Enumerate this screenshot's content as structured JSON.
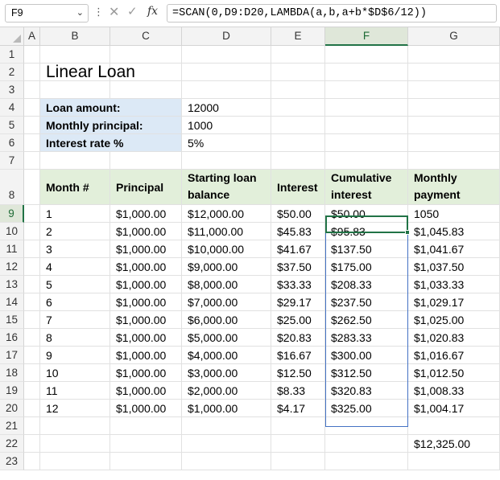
{
  "formula_bar": {
    "name_box": "F9",
    "formula": "=SCAN(0,D9:D20,LAMBDA(a,b,a+b*$D$6/12))",
    "cancel_icon": "close-icon",
    "enter_icon": "check-icon",
    "fx_label": "fx"
  },
  "columns": [
    "A",
    "B",
    "C",
    "D",
    "E",
    "F",
    "G"
  ],
  "rows": [
    "1",
    "2",
    "3",
    "4",
    "5",
    "6",
    "7",
    "8",
    "9",
    "10",
    "11",
    "12",
    "13",
    "14",
    "15",
    "16",
    "17",
    "18",
    "19",
    "20",
    "21",
    "22",
    "23"
  ],
  "selected_column": "F",
  "selected_row": "9",
  "sheet": {
    "title": "Linear Loan",
    "inputs": [
      {
        "label": "Loan amount:",
        "value": "12000"
      },
      {
        "label": "Monthly principal:",
        "value": "1000"
      },
      {
        "label": "Interest rate %",
        "value": "5%"
      }
    ],
    "table_headers": {
      "month": "Month #",
      "principal": "Principal",
      "starting_balance_1": "Starting loan",
      "starting_balance_2": "balance",
      "interest": "Interest",
      "cumulative_1": "Cumulative",
      "cumulative_2": "interest",
      "monthly_1": "Monthly",
      "monthly_2": "payment"
    },
    "table_rows": [
      {
        "month": "1",
        "principal": "$1,000.00",
        "balance": "$12,000.00",
        "interest": "$50.00",
        "cumulative": "$50.00",
        "payment": "1050"
      },
      {
        "month": "2",
        "principal": "$1,000.00",
        "balance": "$11,000.00",
        "interest": "$45.83",
        "cumulative": "$95.83",
        "payment": "$1,045.83"
      },
      {
        "month": "3",
        "principal": "$1,000.00",
        "balance": "$10,000.00",
        "interest": "$41.67",
        "cumulative": "$137.50",
        "payment": "$1,041.67"
      },
      {
        "month": "4",
        "principal": "$1,000.00",
        "balance": "$9,000.00",
        "interest": "$37.50",
        "cumulative": "$175.00",
        "payment": "$1,037.50"
      },
      {
        "month": "5",
        "principal": "$1,000.00",
        "balance": "$8,000.00",
        "interest": "$33.33",
        "cumulative": "$208.33",
        "payment": "$1,033.33"
      },
      {
        "month": "6",
        "principal": "$1,000.00",
        "balance": "$7,000.00",
        "interest": "$29.17",
        "cumulative": "$237.50",
        "payment": "$1,029.17"
      },
      {
        "month": "7",
        "principal": "$1,000.00",
        "balance": "$6,000.00",
        "interest": "$25.00",
        "cumulative": "$262.50",
        "payment": "$1,025.00"
      },
      {
        "month": "8",
        "principal": "$1,000.00",
        "balance": "$5,000.00",
        "interest": "$20.83",
        "cumulative": "$283.33",
        "payment": "$1,020.83"
      },
      {
        "month": "9",
        "principal": "$1,000.00",
        "balance": "$4,000.00",
        "interest": "$16.67",
        "cumulative": "$300.00",
        "payment": "$1,016.67"
      },
      {
        "month": "10",
        "principal": "$1,000.00",
        "balance": "$3,000.00",
        "interest": "$12.50",
        "cumulative": "$312.50",
        "payment": "$1,012.50"
      },
      {
        "month": "11",
        "principal": "$1,000.00",
        "balance": "$2,000.00",
        "interest": "$8.33",
        "cumulative": "$320.83",
        "payment": "$1,008.33"
      },
      {
        "month": "12",
        "principal": "$1,000.00",
        "balance": "$1,000.00",
        "interest": "$4.17",
        "cumulative": "$325.00",
        "payment": "$1,004.17"
      }
    ],
    "total_payment": "$12,325.00"
  },
  "colors": {
    "input_fill": "#dce9f6",
    "header_fill": "#e2efda",
    "selection": "#217346",
    "spill_border": "#4472c4"
  }
}
